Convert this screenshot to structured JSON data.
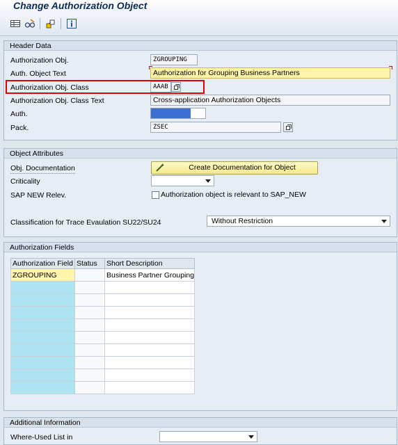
{
  "title": "Change Authorization Object",
  "toolbar": {
    "icons": [
      "display-table-icon",
      "glasses-icon",
      "where-used-icon",
      "info-icon"
    ]
  },
  "header_data": {
    "heading": "Header Data",
    "auth_obj_label": "Authorization Obj.",
    "auth_obj_value": "ZGROUPING",
    "auth_text_label": "Auth. Object Text",
    "auth_text_value": "Authorization for Grouping Business Partners",
    "class_label": "Authorization Obj. Class",
    "class_value": "AAAB",
    "class_text_label": "Authorization Obj. Class Text",
    "class_text_value": "Cross-application Authorization Objects",
    "auth_label": "Auth.",
    "pack_label": "Pack.",
    "pack_value": "ZSEC"
  },
  "object_attributes": {
    "heading": "Object Attributes",
    "doc_label": "Obj. Documentation",
    "doc_button": "Create Documentation for Object",
    "criticality_label": "Criticality",
    "criticality_value": "",
    "sapnew_label": "SAP NEW Relev.",
    "sapnew_checkbox_label": "Authorization object is relevant to SAP_NEW",
    "sapnew_checked": false,
    "classification_label": "Classification for Trace Evaulation SU22/SU24",
    "classification_value": "Without Restriction"
  },
  "authorization_fields": {
    "heading": "Authorization Fields",
    "columns": [
      "Authorization Field",
      "Status",
      "Short Description"
    ],
    "rows": [
      [
        "ZGROUPING",
        "",
        "Business Partner Grouping"
      ]
    ]
  },
  "additional_info": {
    "heading": "Additional Information",
    "where_used_label": "Where-Used List in",
    "where_used_value": ""
  },
  "colors": {
    "background": "#dfe6ee",
    "highlight_red": "#e00000",
    "input_yellow": "#fff4a8",
    "column_cyan": "#aee3f1",
    "title_blue": "#0b2a5a",
    "auth_bar_blue": "#3b6fd1"
  }
}
